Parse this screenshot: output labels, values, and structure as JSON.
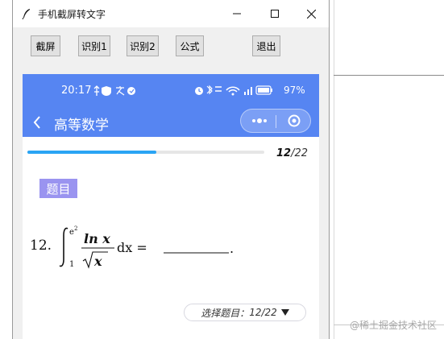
{
  "window": {
    "title": "手机截屏转文字",
    "controls": {
      "minimize": "─",
      "maximize": "☐",
      "close": "✕"
    }
  },
  "toolbar": {
    "screenshot": "截屏",
    "recognize1": "识别1",
    "recognize2": "识别2",
    "formula": "公式",
    "exit": "退出"
  },
  "phone": {
    "status": {
      "time": "20:17",
      "battery": "97%"
    },
    "nav": {
      "title": "高等数学"
    },
    "progress": {
      "current": "12",
      "total": "/22",
      "fraction": 0.545
    },
    "question": {
      "badge": "题目",
      "number": "12.",
      "formula": {
        "upper_limit": "e",
        "upper_limit_exp": "2",
        "lower_limit": "1",
        "numerator": "ln x",
        "denominator": "x",
        "tail": "dx ="
      }
    },
    "selector": {
      "label": "选择题目：",
      "value": "12/22"
    }
  },
  "desktop": {
    "watermark": "@稀土掘金技术社区"
  },
  "colors": {
    "accent": "#5685f2",
    "progress": "#2aa4f4",
    "badge": "#9a94f0"
  }
}
